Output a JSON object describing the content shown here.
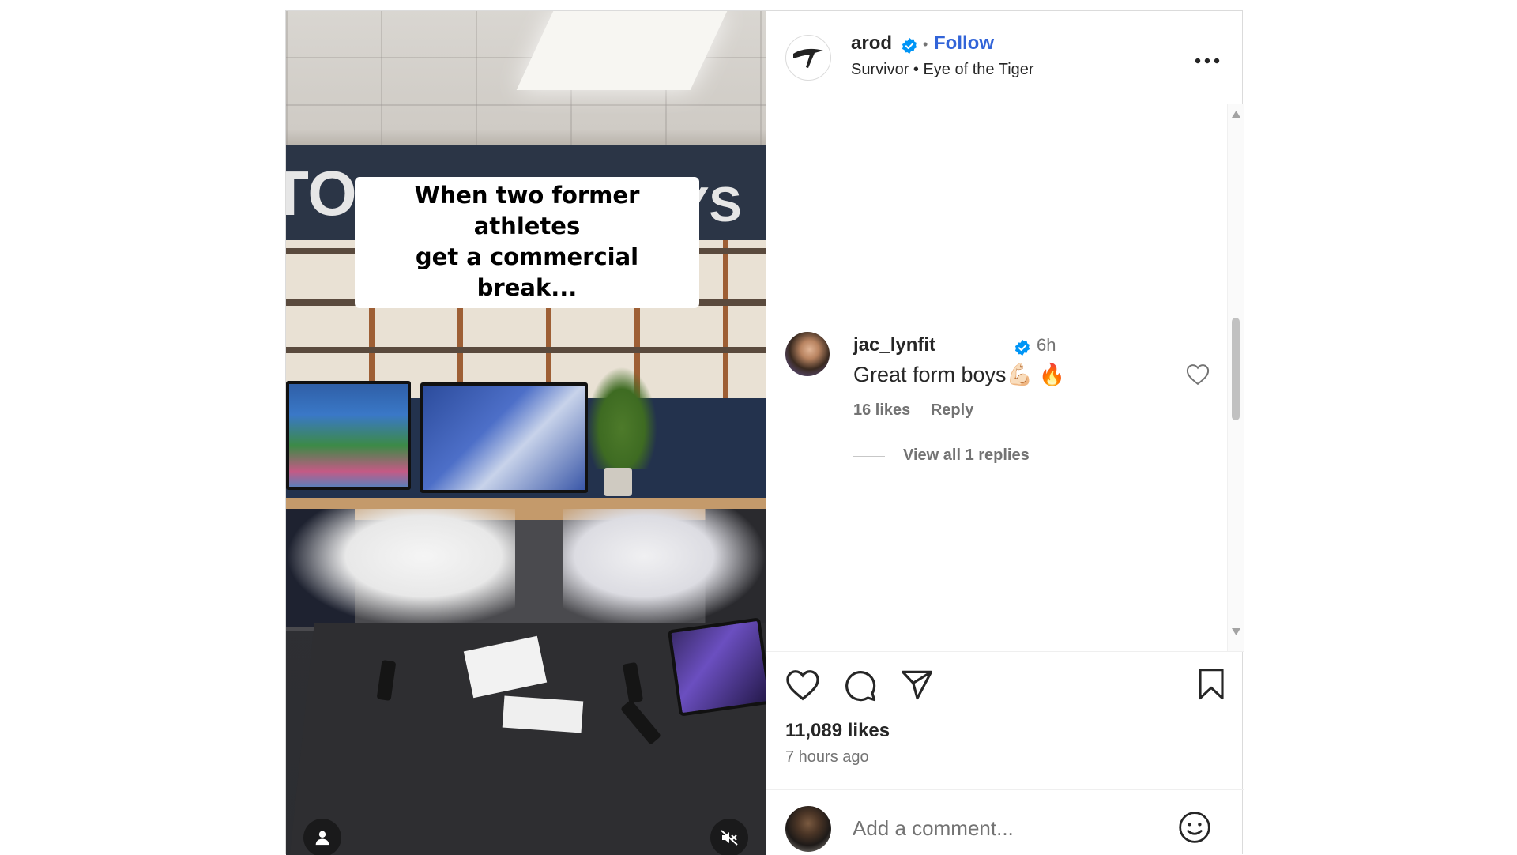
{
  "video": {
    "caption_line1": "When two former athletes",
    "caption_line2": "get a commercial break...",
    "user_tag_icon": "person-icon",
    "mute_icon": "speaker-muted-icon"
  },
  "header": {
    "username": "arod",
    "separator": "•",
    "follow_label": "Follow",
    "audio": "Survivor • Eye of the Tiger",
    "more_icon": "more-options-icon"
  },
  "comments": [
    {
      "username": "jac_lynfit",
      "time": "6h",
      "text": "Great form boys💪🏻 🔥",
      "likes": "16 likes",
      "reply_label": "Reply",
      "view_replies": "View all 1 replies"
    }
  ],
  "actions": {
    "likes": "11,089 likes",
    "time_ago": "7 hours ago"
  },
  "comment_box": {
    "placeholder": "Add a comment..."
  },
  "colors": {
    "follow": "#3264d8",
    "verified": "#0095f6",
    "text": "#262626",
    "muted": "#737373"
  }
}
